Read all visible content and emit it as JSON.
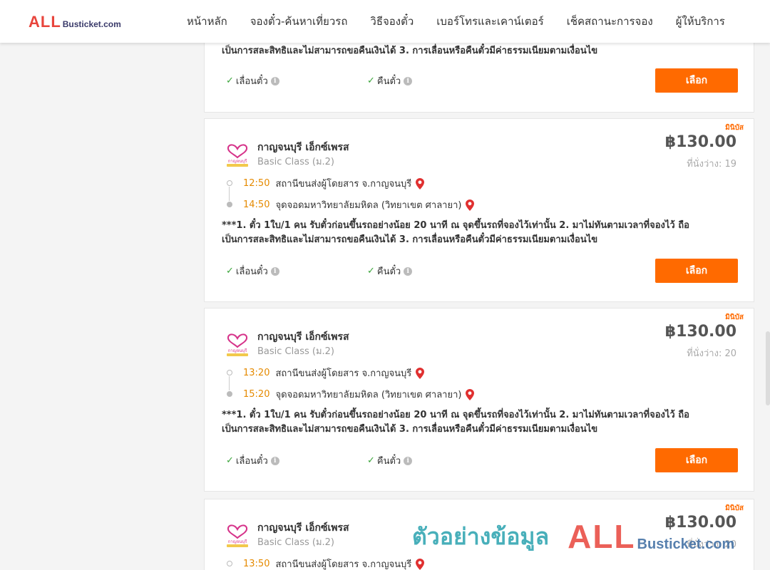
{
  "header": {
    "logo": {
      "all": "ALL",
      "rest": "Busticket.com"
    },
    "nav": [
      {
        "label": "หน้าหลัก"
      },
      {
        "label": "จองตั๋ว-ค้นหาเที่ยวรถ"
      },
      {
        "label": "วิธีจองตั๋ว"
      },
      {
        "label": "เบอร์โทรและเคาน์เตอร์"
      },
      {
        "label": "เช็คสถานะการจอง"
      },
      {
        "label": "ผู้ให้บริการ"
      }
    ]
  },
  "trips": [
    {
      "terms": "เป็นการสละสิทธิและไม่สามารถขอคืนเงินได้ 3. การเลื่อนหรือคืนตั๋วมีค่าธรรมเนียมตามเงื่อนไข",
      "features": {
        "reschedule": "เลื่อนตั๋ว",
        "refund": "คืนตั๋ว"
      },
      "button": "เลือก"
    },
    {
      "bus_type": "มินิบัส",
      "operator": "กาญจนบุรี เอ็กซ์เพรส",
      "class": "Basic Class (ม.2)",
      "price": "฿130.00",
      "seats": "ที่นั่งว่าง: 19",
      "depart_time": "12:50",
      "depart_place": "สถานีขนส่งผู้โดยสาร จ.กาญจนบุรี",
      "arrive_time": "14:50",
      "arrive_place": "จุดจอดมหาวิทยาลัยมหิดล (วิทยาเขต ศาลายา)",
      "terms_line1": "***1. ตั๋ว 1ใบ/1 คน รับตั๋วก่อนขึ้นรถอย่างน้อย 20 นาที ณ จุดขึ้นรถที่จองไว้เท่านั้น 2. มาไม่ทันตามเวลาที่จองไว้ ถือ",
      "terms_line2": "เป็นการสละสิทธิและไม่สามารถขอคืนเงินได้ 3. การเลื่อนหรือคืนตั๋วมีค่าธรรมเนียมตามเงื่อนไข",
      "features": {
        "reschedule": "เลื่อนตั๋ว",
        "refund": "คืนตั๋ว"
      },
      "button": "เลือก"
    },
    {
      "bus_type": "มินิบัส",
      "operator": "กาญจนบุรี เอ็กซ์เพรส",
      "class": "Basic Class (ม.2)",
      "price": "฿130.00",
      "seats": "ที่นั่งว่าง: 20",
      "depart_time": "13:20",
      "depart_place": "สถานีขนส่งผู้โดยสาร จ.กาญจนบุรี",
      "arrive_time": "15:20",
      "arrive_place": "จุดจอดมหาวิทยาลัยมหิดล (วิทยาเขต ศาลายา)",
      "terms_line1": "***1. ตั๋ว 1ใบ/1 คน รับตั๋วก่อนขึ้นรถอย่างน้อย 20 นาที ณ จุดขึ้นรถที่จองไว้เท่านั้น 2. มาไม่ทันตามเวลาที่จองไว้ ถือ",
      "terms_line2": "เป็นการสละสิทธิและไม่สามารถขอคืนเงินได้ 3. การเลื่อนหรือคืนตั๋วมีค่าธรรมเนียมตามเงื่อนไข",
      "features": {
        "reschedule": "เลื่อนตั๋ว",
        "refund": "คืนตั๋ว"
      },
      "button": "เลือก"
    },
    {
      "bus_type": "มินิบัส",
      "operator": "กาญจนบุรี เอ็กซ์เพรส",
      "class": "Basic Class (ม.2)",
      "price": "฿130.00",
      "seats": "ที่นั่งว่าง: 20",
      "depart_time": "13:50",
      "depart_place": "สถานีขนส่งผู้โดยสาร จ.กาญจนบุรี"
    }
  ],
  "watermark": {
    "text": "ตัวอย่างข้อมูล",
    "all": "ALL",
    "rest": "Busticket.com"
  },
  "colors": {
    "accent": "#ff6a00",
    "time": "#e58a00",
    "check": "#3aa53a",
    "pin": "#e03030",
    "watermark_text": "#35a7b3"
  }
}
